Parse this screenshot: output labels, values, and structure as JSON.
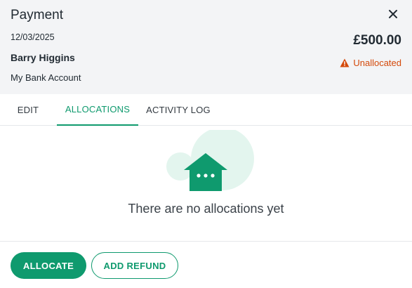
{
  "header": {
    "title": "Payment",
    "date": "12/03/2025",
    "name": "Barry Higgins",
    "account": "My Bank Account",
    "amount": "£500.00",
    "status": "Unallocated",
    "status_color": "#d4490a"
  },
  "tabs": [
    {
      "label": "EDIT",
      "active": false
    },
    {
      "label": "ALLOCATIONS",
      "active": true
    },
    {
      "label": "ACTIVITY LOG",
      "active": false
    }
  ],
  "empty_state": {
    "message": "There are no allocations yet",
    "icon": "house-icon"
  },
  "footer": {
    "allocate_label": "ALLOCATE",
    "add_refund_label": "ADD REFUND"
  },
  "colors": {
    "accent": "#0f9a6e",
    "header_bg": "#f3f4f6"
  }
}
